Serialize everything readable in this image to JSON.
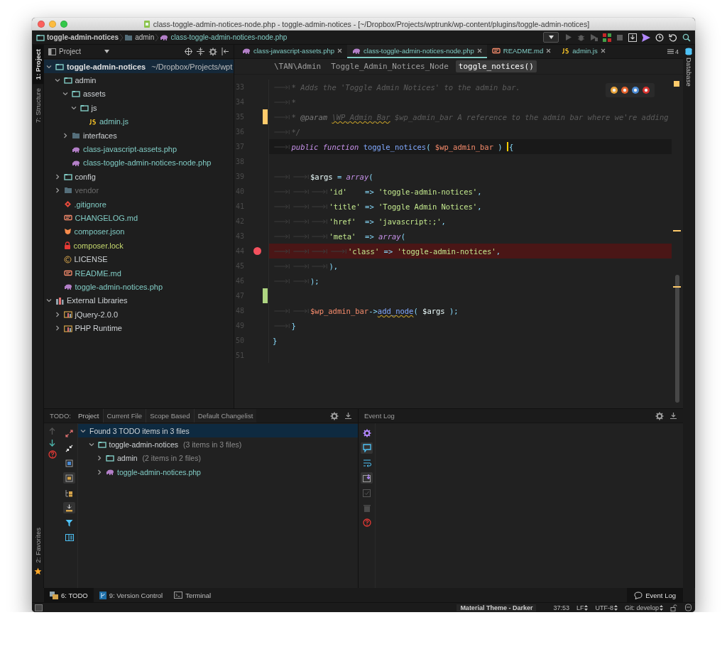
{
  "window": {
    "title": "class-toggle-admin-notices-node.php - toggle-admin-notices - [~/Dropbox/Projects/wptrunk/wp-content/plugins/toggle-admin-notices]"
  },
  "nav_breadcrumbs": [
    {
      "label": "toggle-admin-notices",
      "kind": "folder"
    },
    {
      "label": "admin",
      "kind": "plain_folder"
    },
    {
      "label": "class-toggle-admin-notices-node.php",
      "kind": "php"
    }
  ],
  "left_stripe": [
    {
      "label": "1: Project",
      "selected": true
    },
    {
      "label": "7: Structure",
      "selected": false
    }
  ],
  "favorites_tab": {
    "label": "2: Favorites"
  },
  "project_panel": {
    "title": "Project",
    "tree": [
      {
        "name": "toggle-admin-notices",
        "path": "~/Dropbox/Projects/wpt",
        "kind": "root_folder",
        "color": "#e0e0e0",
        "expanded": true,
        "selected": true,
        "children": [
          {
            "name": "admin",
            "kind": "folder",
            "color": "#cfd3d6",
            "expanded": true,
            "selected": false,
            "children": [
              {
                "name": "assets",
                "kind": "folder",
                "color": "#cfd3d6",
                "expanded": true,
                "selected": false,
                "children": [
                  {
                    "name": "js",
                    "kind": "folder",
                    "expanded": true,
                    "selected": false,
                    "children": [
                      {
                        "name": "admin.js",
                        "kind": "js",
                        "color": "#80cbc4",
                        "selected": false
                      }
                    ]
                  }
                ]
              },
              {
                "name": "interfaces",
                "kind": "plain_folder",
                "color": "#cfd3d6",
                "expanded": false,
                "selected": false
              },
              {
                "name": "class-javascript-assets.php",
                "kind": "php",
                "color": "#80cbc4",
                "selected": false
              },
              {
                "name": "class-toggle-admin-notices-node.php",
                "kind": "php",
                "color": "#80cbc4",
                "selected": false
              }
            ]
          },
          {
            "name": "config",
            "kind": "folder",
            "color": "#cfd3d6",
            "expanded": false,
            "selected": false
          },
          {
            "name": "vendor",
            "kind": "plain_folder",
            "color": "#6b6b6b",
            "expanded": false,
            "selected": false
          },
          {
            "name": ".gitignore",
            "kind": "git",
            "color": "#80cbc4",
            "selected": false
          },
          {
            "name": "CHANGELOG.md",
            "kind": "md",
            "color": "#80cbc4",
            "selected": false
          },
          {
            "name": "composer.json",
            "kind": "composer",
            "color": "#80cbc4",
            "selected": false
          },
          {
            "name": "composer.lock",
            "kind": "lock",
            "color": "#c5d86d",
            "selected": false
          },
          {
            "name": "LICENSE",
            "kind": "license",
            "color": "#cfd3d6",
            "selected": false
          },
          {
            "name": "README.md",
            "kind": "md",
            "color": "#80cbc4",
            "selected": false
          },
          {
            "name": "toggle-admin-notices.php",
            "kind": "php",
            "color": "#80cbc4",
            "selected": false
          }
        ]
      },
      {
        "name": "External Libraries",
        "kind": "library",
        "color": "#cfd3d6",
        "expanded": true,
        "selected": false,
        "children": [
          {
            "name": "jQuery-2.0.0",
            "kind": "library_folder",
            "color": "#cfd3d6",
            "expanded": false,
            "selected": false
          },
          {
            "name": "PHP Runtime",
            "kind": "library_folder",
            "color": "#cfd3d6",
            "expanded": false,
            "selected": false
          }
        ]
      }
    ]
  },
  "editor": {
    "tabs": [
      {
        "label": "class-javascript-assets.php",
        "kind": "php",
        "selected": false
      },
      {
        "label": "class-toggle-admin-notices-node.php",
        "kind": "php",
        "selected": true
      },
      {
        "label": "README.md",
        "kind": "md",
        "selected": false
      },
      {
        "label": "admin.js",
        "kind": "js",
        "selected": false
      }
    ],
    "hidden_tab_count": "4",
    "breadcrumbs": [
      {
        "label": "\\TAN\\Admin",
        "selected": false
      },
      {
        "label": "Toggle_Admin_Notices_Node",
        "selected": false
      },
      {
        "label": "toggle_notices()",
        "selected": true
      }
    ],
    "lines": [
      {
        "number": "33",
        "breakpoint": false,
        "tokens": [
          {
            "kind": "tab"
          },
          {
            "kind": "comment",
            "text": "* Adds the 'Toggle Admin Notices' to the admin bar."
          }
        ]
      },
      {
        "number": "34",
        "breakpoint": false,
        "tokens": [
          {
            "kind": "tab"
          },
          {
            "kind": "comment",
            "text": "*"
          }
        ]
      },
      {
        "number": "35",
        "breakpoint": false,
        "kind": "modified",
        "tokens": [
          {
            "kind": "tab"
          },
          {
            "kind": "comment",
            "text": "* "
          },
          {
            "kind": "doctag",
            "text": "@param "
          },
          {
            "kind": "doctype",
            "text": "\\WP_Admin_Bar"
          },
          {
            "kind": "comment",
            "text": " $wp_admin_bar A reference to the admin bar where we're adding"
          }
        ]
      },
      {
        "number": "36",
        "breakpoint": false,
        "tokens": [
          {
            "kind": "tab"
          },
          {
            "kind": "comment",
            "text": "*/"
          }
        ]
      },
      {
        "number": "37",
        "breakpoint": false,
        "tokens": [
          {
            "kind": "tab"
          },
          {
            "kind": "keyword",
            "text": "public function "
          },
          {
            "kind": "function",
            "text": "toggle_notices"
          },
          {
            "kind": "punct",
            "text": "( "
          },
          {
            "kind": "param",
            "text": "$wp_admin_bar"
          },
          {
            "kind": "punct",
            "text": " ) "
          },
          {
            "kind": "caret"
          },
          {
            "kind": "punct",
            "text": "{"
          }
        ]
      },
      {
        "number": "38",
        "breakpoint": false
      },
      {
        "number": "39",
        "breakpoint": false,
        "tokens": [
          {
            "kind": "tab"
          },
          {
            "kind": "tab"
          },
          {
            "kind": "variable",
            "text": "$args "
          },
          {
            "kind": "operator",
            "text": "= "
          },
          {
            "kind": "keyword",
            "text": "array"
          },
          {
            "kind": "punct",
            "text": "("
          }
        ]
      },
      {
        "number": "40",
        "breakpoint": false,
        "tokens": [
          {
            "kind": "tab"
          },
          {
            "kind": "tab"
          },
          {
            "kind": "tab"
          },
          {
            "kind": "string",
            "text": "'id'    "
          },
          {
            "kind": "operator",
            "text": "=> "
          },
          {
            "kind": "string",
            "text": "'toggle-admin-notices'"
          },
          {
            "kind": "punct",
            "text": ","
          }
        ]
      },
      {
        "number": "41",
        "breakpoint": false,
        "tokens": [
          {
            "kind": "tab"
          },
          {
            "kind": "tab"
          },
          {
            "kind": "tab"
          },
          {
            "kind": "string",
            "text": "'title' "
          },
          {
            "kind": "operator",
            "text": "=> "
          },
          {
            "kind": "string",
            "text": "'Toggle Admin Notices'"
          },
          {
            "kind": "punct",
            "text": ","
          }
        ]
      },
      {
        "number": "42",
        "breakpoint": false,
        "tokens": [
          {
            "kind": "tab"
          },
          {
            "kind": "tab"
          },
          {
            "kind": "tab"
          },
          {
            "kind": "string",
            "text": "'href'  "
          },
          {
            "kind": "operator",
            "text": "=> "
          },
          {
            "kind": "string",
            "text": "'javascript:;'"
          },
          {
            "kind": "punct",
            "text": ","
          }
        ]
      },
      {
        "number": "43",
        "breakpoint": false,
        "tokens": [
          {
            "kind": "tab"
          },
          {
            "kind": "tab"
          },
          {
            "kind": "tab"
          },
          {
            "kind": "string",
            "text": "'meta'  "
          },
          {
            "kind": "operator",
            "text": "=> "
          },
          {
            "kind": "keyword",
            "text": "array"
          },
          {
            "kind": "punct",
            "text": "("
          }
        ]
      },
      {
        "number": "44",
        "breakpoint": true,
        "tokens": [
          {
            "kind": "tab"
          },
          {
            "kind": "tab"
          },
          {
            "kind": "tab"
          },
          {
            "kind": "tab"
          },
          {
            "kind": "string",
            "text": "'class' "
          },
          {
            "kind": "operator",
            "text": "=> "
          },
          {
            "kind": "string",
            "text": "'toggle-admin-notices'"
          },
          {
            "kind": "punct",
            "text": ","
          }
        ]
      },
      {
        "number": "45",
        "breakpoint": false,
        "tokens": [
          {
            "kind": "tab"
          },
          {
            "kind": "tab"
          },
          {
            "kind": "tab"
          },
          {
            "kind": "punct",
            "text": "),"
          }
        ]
      },
      {
        "number": "46",
        "breakpoint": false,
        "tokens": [
          {
            "kind": "tab"
          },
          {
            "kind": "tab"
          },
          {
            "kind": "punct",
            "text": ");"
          }
        ]
      },
      {
        "number": "47",
        "breakpoint": false,
        "kind": "added"
      },
      {
        "number": "48",
        "breakpoint": false,
        "tokens": [
          {
            "kind": "tab"
          },
          {
            "kind": "tab"
          },
          {
            "kind": "param",
            "text": "$wp_admin_bar"
          },
          {
            "kind": "operator",
            "text": "->"
          },
          {
            "kind": "method",
            "text": "add_node"
          },
          {
            "kind": "punct",
            "text": "( "
          },
          {
            "kind": "variable",
            "text": "$args"
          },
          {
            "kind": "punct",
            "text": " );"
          }
        ]
      },
      {
        "number": "49",
        "breakpoint": false,
        "tokens": [
          {
            "kind": "tab"
          },
          {
            "kind": "punct",
            "text": "}"
          }
        ]
      },
      {
        "number": "50",
        "breakpoint": false,
        "tokens": [
          {
            "kind": "punct",
            "text": "}"
          }
        ]
      },
      {
        "number": "51",
        "breakpoint": false
      }
    ]
  },
  "right_stripe": {
    "label": "Database"
  },
  "todo": {
    "title": "TODO:",
    "tabs": [
      {
        "label": "Project",
        "selected": true
      },
      {
        "label": "Current File",
        "selected": false
      },
      {
        "label": "Scope Based",
        "selected": false
      },
      {
        "label": "Default Changelist",
        "selected": false
      }
    ],
    "tree": [
      {
        "name": "Found 3 TODO items in 3 files",
        "kind": "summary",
        "color": "#cfd3d6",
        "expanded": true,
        "selected": true,
        "children": [
          {
            "name": "toggle-admin-notices",
            "detail": "(3 items in 3 files)",
            "kind": "folder",
            "color": "#cfd3d6",
            "expanded": true,
            "selected": false,
            "children": [
              {
                "name": "admin",
                "detail": "(2 items in 2 files)",
                "kind": "folder",
                "color": "#cfd3d6",
                "expanded": false,
                "selected": false
              },
              {
                "name": "toggle-admin-notices.php",
                "kind": "php",
                "color": "#80cbc4",
                "expanded": false,
                "selected": false
              }
            ]
          }
        ]
      }
    ]
  },
  "event_log": {
    "title": "Event Log"
  },
  "bottom_tabs": [
    {
      "label": "6: TODO",
      "kind": "todo",
      "selected": true
    },
    {
      "label": "9: Version Control",
      "kind": "vcs",
      "selected": false
    },
    {
      "label": "Terminal",
      "kind": "terminal",
      "selected": false
    }
  ],
  "event_log_button": {
    "label": "Event Log"
  },
  "status_bar": {
    "theme": "Material Theme - Darker",
    "position": "37:53",
    "line_separator": "LF",
    "encoding": "UTF-8",
    "vcs_branch": "Git: develop"
  }
}
